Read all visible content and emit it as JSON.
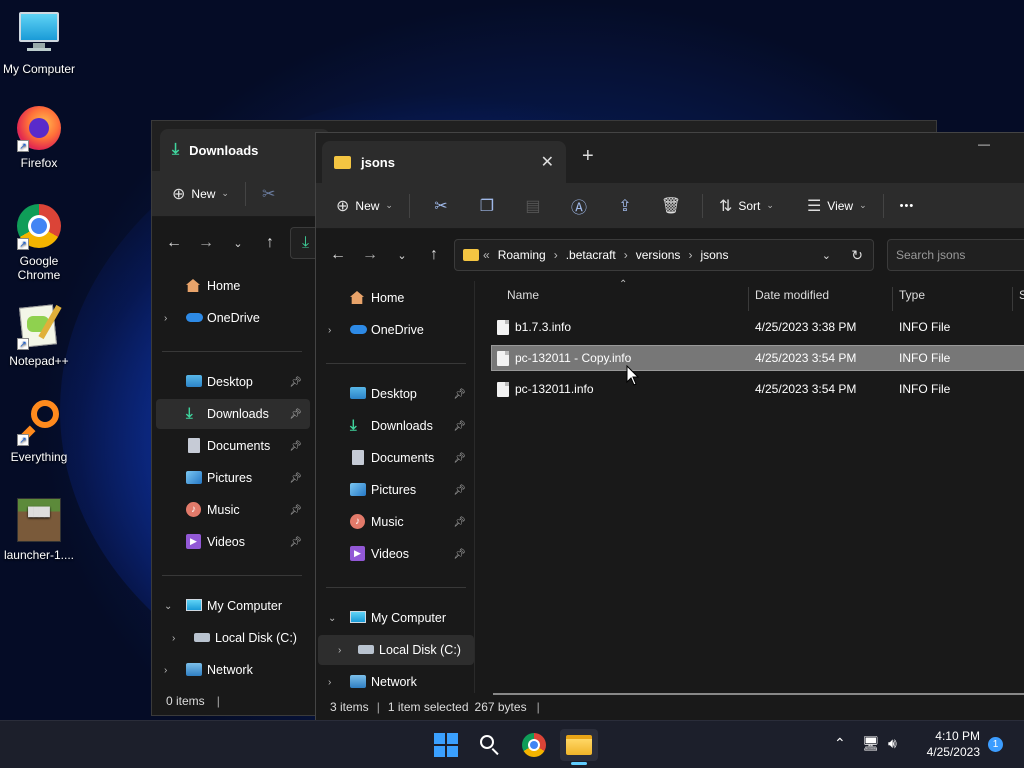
{
  "desktop": {
    "icons": [
      {
        "label": "My Computer"
      },
      {
        "label": "Firefox"
      },
      {
        "label": "Google Chrome"
      },
      {
        "label": "Notepad++"
      },
      {
        "label": "Everything"
      },
      {
        "label": "launcher-1...."
      }
    ]
  },
  "back_window": {
    "tab_title": "Downloads",
    "new_label": "New",
    "sidebar": {
      "home": "Home",
      "onedrive": "OneDrive",
      "desktop": "Desktop",
      "downloads": "Downloads",
      "documents": "Documents",
      "pictures": "Pictures",
      "music": "Music",
      "videos": "Videos",
      "my_computer": "My Computer",
      "local_disk": "Local Disk (C:)",
      "network": "Network"
    },
    "status": "0 items"
  },
  "front_window": {
    "tab_title": "jsons",
    "new_tab_symbol": "+",
    "minimize_symbol": "—",
    "toolbar": {
      "new_label": "New",
      "sort_label": "Sort",
      "view_label": "View",
      "more_symbol": "•••"
    },
    "address": {
      "overflow": "«",
      "crumbs": [
        "Roaming",
        ".betacraft",
        "versions",
        "jsons"
      ],
      "separator": "›"
    },
    "search_placeholder": "Search jsons",
    "sidebar": {
      "home": "Home",
      "onedrive": "OneDrive",
      "desktop": "Desktop",
      "downloads": "Downloads",
      "documents": "Documents",
      "pictures": "Pictures",
      "music": "Music",
      "videos": "Videos",
      "my_computer": "My Computer",
      "local_disk": "Local Disk (C:)",
      "network": "Network"
    },
    "columns": {
      "name": "Name",
      "date": "Date modified",
      "type": "Type",
      "size": "S"
    },
    "files": [
      {
        "name": "b1.7.3.info",
        "date": "4/25/2023 3:38 PM",
        "type": "INFO File",
        "selected": false
      },
      {
        "name": "pc-132011 - Copy.info",
        "date": "4/25/2023 3:54 PM",
        "type": "INFO File",
        "selected": true
      },
      {
        "name": "pc-132011.info",
        "date": "4/25/2023 3:54 PM",
        "type": "INFO File",
        "selected": false
      }
    ],
    "status": {
      "items": "3 items",
      "selected": "1 item selected",
      "size": "267 bytes"
    }
  },
  "taskbar": {
    "time": "4:10 PM",
    "date": "4/25/2023",
    "notification_count": "1"
  },
  "colors": {
    "accent": "#60cdff",
    "selection": "#777777",
    "window_bg": "#191919",
    "taskbar_bg": "#1c1f2b"
  }
}
